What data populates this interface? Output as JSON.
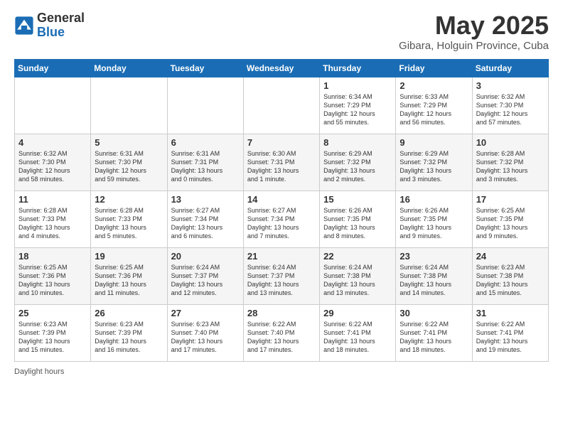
{
  "header": {
    "logo_general": "General",
    "logo_blue": "Blue",
    "title": "May 2025",
    "subtitle": "Gibara, Holguin Province, Cuba"
  },
  "weekdays": [
    "Sunday",
    "Monday",
    "Tuesday",
    "Wednesday",
    "Thursday",
    "Friday",
    "Saturday"
  ],
  "weeks": [
    [
      {
        "day": "",
        "info": ""
      },
      {
        "day": "",
        "info": ""
      },
      {
        "day": "",
        "info": ""
      },
      {
        "day": "",
        "info": ""
      },
      {
        "day": "1",
        "info": "Sunrise: 6:34 AM\nSunset: 7:29 PM\nDaylight: 12 hours\nand 55 minutes."
      },
      {
        "day": "2",
        "info": "Sunrise: 6:33 AM\nSunset: 7:29 PM\nDaylight: 12 hours\nand 56 minutes."
      },
      {
        "day": "3",
        "info": "Sunrise: 6:32 AM\nSunset: 7:30 PM\nDaylight: 12 hours\nand 57 minutes."
      }
    ],
    [
      {
        "day": "4",
        "info": "Sunrise: 6:32 AM\nSunset: 7:30 PM\nDaylight: 12 hours\nand 58 minutes."
      },
      {
        "day": "5",
        "info": "Sunrise: 6:31 AM\nSunset: 7:30 PM\nDaylight: 12 hours\nand 59 minutes."
      },
      {
        "day": "6",
        "info": "Sunrise: 6:31 AM\nSunset: 7:31 PM\nDaylight: 13 hours\nand 0 minutes."
      },
      {
        "day": "7",
        "info": "Sunrise: 6:30 AM\nSunset: 7:31 PM\nDaylight: 13 hours\nand 1 minute."
      },
      {
        "day": "8",
        "info": "Sunrise: 6:29 AM\nSunset: 7:32 PM\nDaylight: 13 hours\nand 2 minutes."
      },
      {
        "day": "9",
        "info": "Sunrise: 6:29 AM\nSunset: 7:32 PM\nDaylight: 13 hours\nand 3 minutes."
      },
      {
        "day": "10",
        "info": "Sunrise: 6:28 AM\nSunset: 7:32 PM\nDaylight: 13 hours\nand 3 minutes."
      }
    ],
    [
      {
        "day": "11",
        "info": "Sunrise: 6:28 AM\nSunset: 7:33 PM\nDaylight: 13 hours\nand 4 minutes."
      },
      {
        "day": "12",
        "info": "Sunrise: 6:28 AM\nSunset: 7:33 PM\nDaylight: 13 hours\nand 5 minutes."
      },
      {
        "day": "13",
        "info": "Sunrise: 6:27 AM\nSunset: 7:34 PM\nDaylight: 13 hours\nand 6 minutes."
      },
      {
        "day": "14",
        "info": "Sunrise: 6:27 AM\nSunset: 7:34 PM\nDaylight: 13 hours\nand 7 minutes."
      },
      {
        "day": "15",
        "info": "Sunrise: 6:26 AM\nSunset: 7:35 PM\nDaylight: 13 hours\nand 8 minutes."
      },
      {
        "day": "16",
        "info": "Sunrise: 6:26 AM\nSunset: 7:35 PM\nDaylight: 13 hours\nand 9 minutes."
      },
      {
        "day": "17",
        "info": "Sunrise: 6:25 AM\nSunset: 7:35 PM\nDaylight: 13 hours\nand 9 minutes."
      }
    ],
    [
      {
        "day": "18",
        "info": "Sunrise: 6:25 AM\nSunset: 7:36 PM\nDaylight: 13 hours\nand 10 minutes."
      },
      {
        "day": "19",
        "info": "Sunrise: 6:25 AM\nSunset: 7:36 PM\nDaylight: 13 hours\nand 11 minutes."
      },
      {
        "day": "20",
        "info": "Sunrise: 6:24 AM\nSunset: 7:37 PM\nDaylight: 13 hours\nand 12 minutes."
      },
      {
        "day": "21",
        "info": "Sunrise: 6:24 AM\nSunset: 7:37 PM\nDaylight: 13 hours\nand 13 minutes."
      },
      {
        "day": "22",
        "info": "Sunrise: 6:24 AM\nSunset: 7:38 PM\nDaylight: 13 hours\nand 13 minutes."
      },
      {
        "day": "23",
        "info": "Sunrise: 6:24 AM\nSunset: 7:38 PM\nDaylight: 13 hours\nand 14 minutes."
      },
      {
        "day": "24",
        "info": "Sunrise: 6:23 AM\nSunset: 7:38 PM\nDaylight: 13 hours\nand 15 minutes."
      }
    ],
    [
      {
        "day": "25",
        "info": "Sunrise: 6:23 AM\nSunset: 7:39 PM\nDaylight: 13 hours\nand 15 minutes."
      },
      {
        "day": "26",
        "info": "Sunrise: 6:23 AM\nSunset: 7:39 PM\nDaylight: 13 hours\nand 16 minutes."
      },
      {
        "day": "27",
        "info": "Sunrise: 6:23 AM\nSunset: 7:40 PM\nDaylight: 13 hours\nand 17 minutes."
      },
      {
        "day": "28",
        "info": "Sunrise: 6:22 AM\nSunset: 7:40 PM\nDaylight: 13 hours\nand 17 minutes."
      },
      {
        "day": "29",
        "info": "Sunrise: 6:22 AM\nSunset: 7:41 PM\nDaylight: 13 hours\nand 18 minutes."
      },
      {
        "day": "30",
        "info": "Sunrise: 6:22 AM\nSunset: 7:41 PM\nDaylight: 13 hours\nand 18 minutes."
      },
      {
        "day": "31",
        "info": "Sunrise: 6:22 AM\nSunset: 7:41 PM\nDaylight: 13 hours\nand 19 minutes."
      }
    ]
  ],
  "footer": {
    "daylight_label": "Daylight hours"
  }
}
